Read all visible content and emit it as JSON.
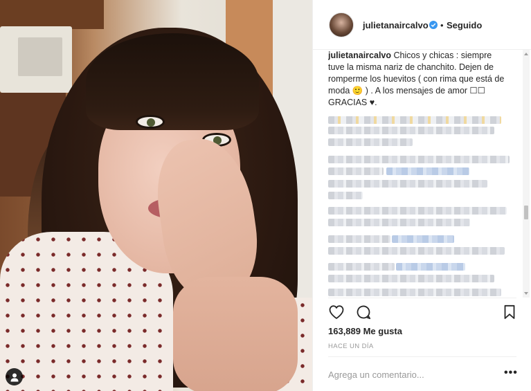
{
  "post": {
    "username": "julietanaircalvo",
    "separator": "•",
    "follow_status": "Seguido",
    "caption_text": " Chicos y chicas : siempre tuve la misma nariz de chanchito. Dejen de romperme los huevitos ( con rima que está de moda 🙂 ) . A los mensajes de amor ☐☐ GRACIAS ♥.",
    "likes": "163,889 Me gusta",
    "timestamp": "HACE UN DÍA"
  },
  "comment_box": {
    "placeholder": "Agrega un comentario...",
    "more_options": "•••"
  },
  "icons": {
    "like": "heart-outline-icon",
    "comment": "speech-bubble-icon",
    "save": "bookmark-icon",
    "verified": "verified-badge-icon",
    "user_tag": "person-icon"
  },
  "colors": {
    "verified_blue": "#3897f0",
    "text": "#262626",
    "muted": "#999999",
    "divider": "#efefef"
  }
}
